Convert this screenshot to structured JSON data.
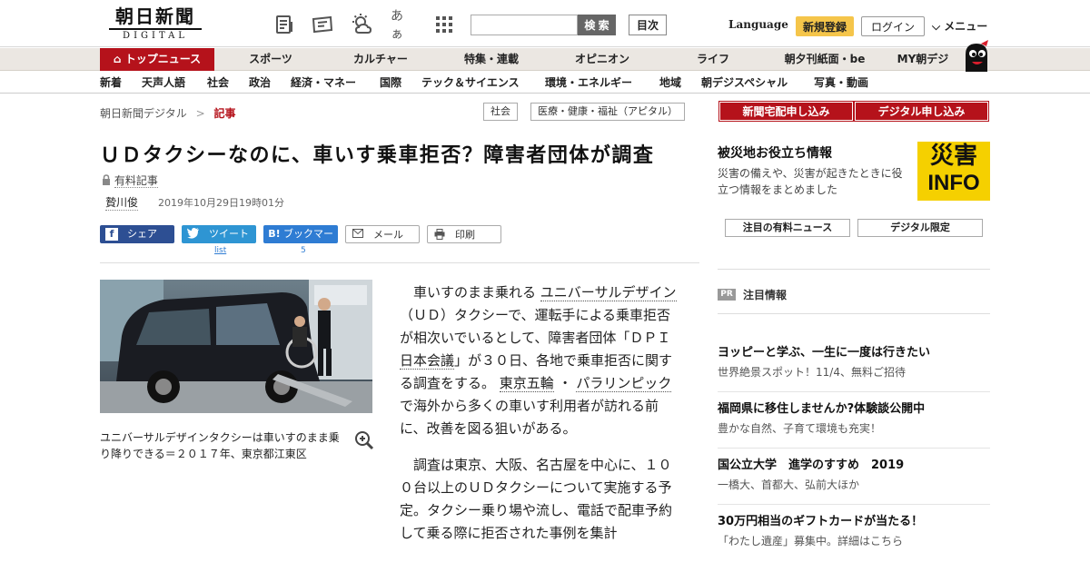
{
  "header": {
    "logo_main": "朝日新聞",
    "logo_sub": "DIGITAL",
    "search_placeholder": "",
    "search_label": "検 索",
    "toc_label": "目次",
    "language_label": "Language",
    "register_label": "新規登録",
    "login_label": "ログイン",
    "menu_label": "メニュー",
    "font_icon_glyph": "あぁ"
  },
  "nav_primary": [
    {
      "label": "トップニュース"
    },
    {
      "label": "スポーツ"
    },
    {
      "label": "カルチャー"
    },
    {
      "label": "特集・連載"
    },
    {
      "label": "オピニオン"
    },
    {
      "label": "ライフ"
    },
    {
      "label": "朝夕刊紙面・be"
    },
    {
      "label": "MY朝デジ"
    }
  ],
  "nav_secondary": [
    {
      "label": "新着"
    },
    {
      "label": "天声人語"
    },
    {
      "label": "社会"
    },
    {
      "label": "政治"
    },
    {
      "label": "経済・マネー"
    },
    {
      "label": "国際"
    },
    {
      "label": "テック＆サイエンス"
    },
    {
      "label": "環境・エネルギー"
    },
    {
      "label": "地域"
    },
    {
      "label": "朝デジスペシャル"
    },
    {
      "label": "写真・動画"
    }
  ],
  "breadcrumb": {
    "home": "朝日新聞デジタル",
    "sep": ">",
    "current": "記事"
  },
  "tags": [
    "社会",
    "医療・健康・福祉（アピタル）"
  ],
  "article": {
    "title": "ＵＤタクシーなのに、車いす乗車拒否？障害者団体が調査",
    "paid_label": "有料記事",
    "author": "贄川俊",
    "date": "2019年10月29日19時01分",
    "share": {
      "facebook": "シェア",
      "twitter": "ツイート",
      "twitter_count": "list",
      "hatena": "ブックマーク",
      "hatena_count": "5",
      "mail": "メール",
      "print": "印刷"
    },
    "photo_caption": "ユニバーサルデザインタクシーは車いすのまま乗り降りできる＝２０１７年、東京都江東区",
    "p1_a": "車いすのまま乗れる",
    "p1_link1": "ユニバーサルデザイン",
    "p1_b": "（ＵＤ）タクシーで、運転手による乗車拒否が相次いでいるとして、障害者団体「ＤＰＩ",
    "p1_link2": "日本会議",
    "p1_c": "」が３０日、各地で乗車拒否に関する調査をする。",
    "p1_link3": "東京五輪",
    "p1_d": "・",
    "p1_link4": "パラリンピック",
    "p1_e": "で海外から多くの車いす利用者が訪れる前に、改善を図る狙いがある。",
    "p2": "調査は東京、大阪、名古屋を中心に、１００台以上のＵＤタクシーについて実施する予定。タクシー乗り場や流し、電話で配車予約して乗る際に拒否された事例を集計"
  },
  "sidebar": {
    "delivery_btn": "新聞宅配申し込み",
    "digital_btn": "デジタル申し込み",
    "disaster_title": "被災地お役立ち情報",
    "disaster_desc": "災害の備えや、災害が起きたときに役立つ情報をまとめました",
    "disaster_img_line1": "災害",
    "disaster_img_line2": "INFO",
    "paid_news_btn": "注目の有料ニュース",
    "digital_only_btn": "デジタル限定",
    "pr_badge": "PR",
    "pr_label": "注目情報",
    "ads": [
      {
        "title": "ヨッピーと学ぶ、一生に一度は行きたい",
        "desc": "世界絶景スポット！11/4、無料ご招待"
      },
      {
        "title": "福岡県に移住しませんか?体験談公開中",
        "desc": "豊かな自然、子育て環境も充実！"
      },
      {
        "title": "国公立大学　進学のすすめ　2019",
        "desc": "一橋大、首都大、弘前大ほか"
      },
      {
        "title": "30万円相当のギフトカードが当たる！",
        "desc": "「わたし遺産」募集中。詳細はこちら"
      }
    ]
  },
  "colors": {
    "accent_red": "#b5121b",
    "register_yellow": "#f5c54a",
    "nav_bg": "#ebe7e2"
  }
}
